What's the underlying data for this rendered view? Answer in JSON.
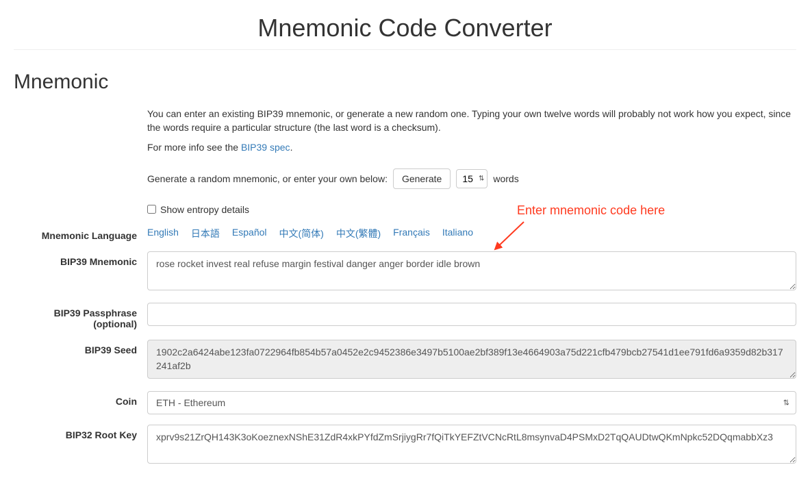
{
  "title": "Mnemonic Code Converter",
  "section_heading": "Mnemonic",
  "intro": {
    "line1": "You can enter an existing BIP39 mnemonic, or generate a new random one. Typing your own twelve words will probably not work how you expect, since the words require a particular structure (the last word is a checksum).",
    "line2_prefix": "For more info see the ",
    "line2_link": "BIP39 spec",
    "line2_suffix": "."
  },
  "generate": {
    "prefix": "Generate a random mnemonic, or enter your own below:",
    "button": "Generate",
    "word_count": "15",
    "suffix": "words"
  },
  "entropy": {
    "label": "Show entropy details"
  },
  "labels": {
    "language": "Mnemonic Language",
    "mnemonic": "BIP39 Mnemonic",
    "passphrase": "BIP39 Passphrase (optional)",
    "seed": "BIP39 Seed",
    "coin": "Coin",
    "root_key": "BIP32 Root Key"
  },
  "languages": [
    "English",
    "日本語",
    "Español",
    "中文(简体)",
    "中文(繁體)",
    "Français",
    "Italiano"
  ],
  "values": {
    "mnemonic": "rose rocket invest real refuse margin festival danger anger border idle brown",
    "passphrase": "",
    "seed": "1902c2a6424abe123fa0722964fb854b57a0452e2c9452386e3497b5100ae2bf389f13e4664903a75d221cfb479bcb27541d1ee791fd6a9359d82b317241af2b",
    "coin": "ETH - Ethereum",
    "root_key": "xprv9s21ZrQH143K3oKoeznexNShE31ZdR4xkPYfdZmSrjiygRr7fQiTkYEFZtVCNcRtL8msynvaD4PSMxD2TqQAUDtwQKmNpkc52DQqmabbXz3"
  },
  "annotation": "Enter mnemonic code here"
}
